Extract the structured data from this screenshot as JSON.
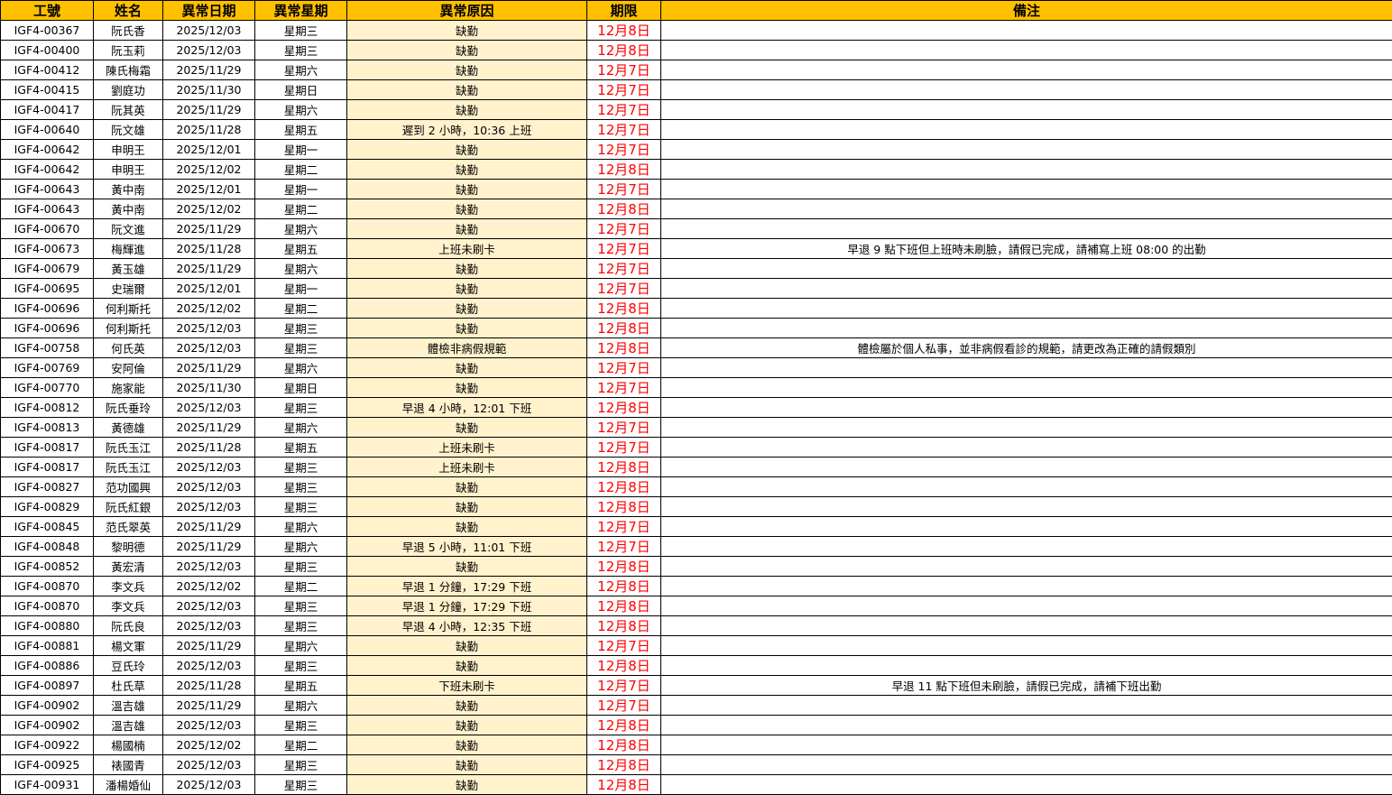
{
  "headers": {
    "id": "工號",
    "name": "姓名",
    "date": "異常日期",
    "weekday": "異常星期",
    "reason": "異常原因",
    "deadline": "期限",
    "note": "備注"
  },
  "colors": {
    "header_background": "#ffc000",
    "reason_background": "#fff2cc",
    "deadline_text": "#ff0000",
    "grid_lines": "#000000"
  },
  "rows": [
    {
      "id": "IGF4-00367",
      "name": "阮氏香",
      "date": "2025/12/03",
      "weekday": "星期三",
      "reason": "缺勤",
      "deadline": "12月8日",
      "note": ""
    },
    {
      "id": "IGF4-00400",
      "name": "阮玉莉",
      "date": "2025/12/03",
      "weekday": "星期三",
      "reason": "缺勤",
      "deadline": "12月8日",
      "note": ""
    },
    {
      "id": "IGF4-00412",
      "name": "陳氏梅霜",
      "date": "2025/11/29",
      "weekday": "星期六",
      "reason": "缺勤",
      "deadline": "12月7日",
      "note": ""
    },
    {
      "id": "IGF4-00415",
      "name": "劉庭功",
      "date": "2025/11/30",
      "weekday": "星期日",
      "reason": "缺勤",
      "deadline": "12月7日",
      "note": ""
    },
    {
      "id": "IGF4-00417",
      "name": "阮其英",
      "date": "2025/11/29",
      "weekday": "星期六",
      "reason": "缺勤",
      "deadline": "12月7日",
      "note": ""
    },
    {
      "id": "IGF4-00640",
      "name": "阮文雄",
      "date": "2025/11/28",
      "weekday": "星期五",
      "reason": "遲到 2 小時，10:36 上班",
      "deadline": "12月7日",
      "note": ""
    },
    {
      "id": "IGF4-00642",
      "name": "申明王",
      "date": "2025/12/01",
      "weekday": "星期一",
      "reason": "缺勤",
      "deadline": "12月7日",
      "note": ""
    },
    {
      "id": "IGF4-00642",
      "name": "申明王",
      "date": "2025/12/02",
      "weekday": "星期二",
      "reason": "缺勤",
      "deadline": "12月8日",
      "note": ""
    },
    {
      "id": "IGF4-00643",
      "name": "黃中南",
      "date": "2025/12/01",
      "weekday": "星期一",
      "reason": "缺勤",
      "deadline": "12月7日",
      "note": ""
    },
    {
      "id": "IGF4-00643",
      "name": "黃中南",
      "date": "2025/12/02",
      "weekday": "星期二",
      "reason": "缺勤",
      "deadline": "12月8日",
      "note": ""
    },
    {
      "id": "IGF4-00670",
      "name": "阮文進",
      "date": "2025/11/29",
      "weekday": "星期六",
      "reason": "缺勤",
      "deadline": "12月7日",
      "note": ""
    },
    {
      "id": "IGF4-00673",
      "name": "梅輝進",
      "date": "2025/11/28",
      "weekday": "星期五",
      "reason": "上班未刷卡",
      "deadline": "12月7日",
      "note": "早退 9 點下班但上班時未刷臉，請假已完成，請補寫上班 08:00 的出勤"
    },
    {
      "id": "IGF4-00679",
      "name": "黃玉雄",
      "date": "2025/11/29",
      "weekday": "星期六",
      "reason": "缺勤",
      "deadline": "12月7日",
      "note": ""
    },
    {
      "id": "IGF4-00695",
      "name": "史瑞爾",
      "date": "2025/12/01",
      "weekday": "星期一",
      "reason": "缺勤",
      "deadline": "12月7日",
      "note": ""
    },
    {
      "id": "IGF4-00696",
      "name": "何利斯托",
      "date": "2025/12/02",
      "weekday": "星期二",
      "reason": "缺勤",
      "deadline": "12月8日",
      "note": ""
    },
    {
      "id": "IGF4-00696",
      "name": "何利斯托",
      "date": "2025/12/03",
      "weekday": "星期三",
      "reason": "缺勤",
      "deadline": "12月8日",
      "note": ""
    },
    {
      "id": "IGF4-00758",
      "name": "何氏英",
      "date": "2025/12/03",
      "weekday": "星期三",
      "reason": "體檢非病假規範",
      "deadline": "12月8日",
      "note": "體檢屬於個人私事，並非病假看診的規範，請更改為正確的請假類別"
    },
    {
      "id": "IGF4-00769",
      "name": "安阿倫",
      "date": "2025/11/29",
      "weekday": "星期六",
      "reason": "缺勤",
      "deadline": "12月7日",
      "note": ""
    },
    {
      "id": "IGF4-00770",
      "name": "施家能",
      "date": "2025/11/30",
      "weekday": "星期日",
      "reason": "缺勤",
      "deadline": "12月7日",
      "note": ""
    },
    {
      "id": "IGF4-00812",
      "name": "阮氏垂玲",
      "date": "2025/12/03",
      "weekday": "星期三",
      "reason": "早退 4 小時，12:01 下班",
      "deadline": "12月8日",
      "note": ""
    },
    {
      "id": "IGF4-00813",
      "name": "黃德雄",
      "date": "2025/11/29",
      "weekday": "星期六",
      "reason": "缺勤",
      "deadline": "12月7日",
      "note": ""
    },
    {
      "id": "IGF4-00817",
      "name": "阮氏玉江",
      "date": "2025/11/28",
      "weekday": "星期五",
      "reason": "上班未刷卡",
      "deadline": "12月7日",
      "note": ""
    },
    {
      "id": "IGF4-00817",
      "name": "阮氏玉江",
      "date": "2025/12/03",
      "weekday": "星期三",
      "reason": "上班未刷卡",
      "deadline": "12月8日",
      "note": ""
    },
    {
      "id": "IGF4-00827",
      "name": "范功國興",
      "date": "2025/12/03",
      "weekday": "星期三",
      "reason": "缺勤",
      "deadline": "12月8日",
      "note": ""
    },
    {
      "id": "IGF4-00829",
      "name": "阮氏紅銀",
      "date": "2025/12/03",
      "weekday": "星期三",
      "reason": "缺勤",
      "deadline": "12月8日",
      "note": ""
    },
    {
      "id": "IGF4-00845",
      "name": "范氏翠英",
      "date": "2025/11/29",
      "weekday": "星期六",
      "reason": "缺勤",
      "deadline": "12月7日",
      "note": ""
    },
    {
      "id": "IGF4-00848",
      "name": "黎明德",
      "date": "2025/11/29",
      "weekday": "星期六",
      "reason": "早退 5 小時，11:01 下班",
      "deadline": "12月7日",
      "note": ""
    },
    {
      "id": "IGF4-00852",
      "name": "黃宏清",
      "date": "2025/12/03",
      "weekday": "星期三",
      "reason": "缺勤",
      "deadline": "12月8日",
      "note": ""
    },
    {
      "id": "IGF4-00870",
      "name": "李文兵",
      "date": "2025/12/02",
      "weekday": "星期二",
      "reason": "早退 1 分鐘，17:29 下班",
      "deadline": "12月8日",
      "note": ""
    },
    {
      "id": "IGF4-00870",
      "name": "李文兵",
      "date": "2025/12/03",
      "weekday": "星期三",
      "reason": "早退 1 分鐘，17:29 下班",
      "deadline": "12月8日",
      "note": ""
    },
    {
      "id": "IGF4-00880",
      "name": "阮氏良",
      "date": "2025/12/03",
      "weekday": "星期三",
      "reason": "早退 4 小時，12:35 下班",
      "deadline": "12月8日",
      "note": ""
    },
    {
      "id": "IGF4-00881",
      "name": "楊文軍",
      "date": "2025/11/29",
      "weekday": "星期六",
      "reason": "缺勤",
      "deadline": "12月7日",
      "note": ""
    },
    {
      "id": "IGF4-00886",
      "name": "豆氏玲",
      "date": "2025/12/03",
      "weekday": "星期三",
      "reason": "缺勤",
      "deadline": "12月8日",
      "note": ""
    },
    {
      "id": "IGF4-00897",
      "name": "杜氏草",
      "date": "2025/11/28",
      "weekday": "星期五",
      "reason": "下班未刷卡",
      "deadline": "12月7日",
      "note": "早退 11 點下班但未刷臉，請假已完成，請補下班出勤"
    },
    {
      "id": "IGF4-00902",
      "name": "溫吉雄",
      "date": "2025/11/29",
      "weekday": "星期六",
      "reason": "缺勤",
      "deadline": "12月7日",
      "note": ""
    },
    {
      "id": "IGF4-00902",
      "name": "溫吉雄",
      "date": "2025/12/03",
      "weekday": "星期三",
      "reason": "缺勤",
      "deadline": "12月8日",
      "note": ""
    },
    {
      "id": "IGF4-00922",
      "name": "楊國楠",
      "date": "2025/12/02",
      "weekday": "星期二",
      "reason": "缺勤",
      "deadline": "12月8日",
      "note": ""
    },
    {
      "id": "IGF4-00925",
      "name": "裱國青",
      "date": "2025/12/03",
      "weekday": "星期三",
      "reason": "缺勤",
      "deadline": "12月8日",
      "note": ""
    },
    {
      "id": "IGF4-00931",
      "name": "潘楊婚仙",
      "date": "2025/12/03",
      "weekday": "星期三",
      "reason": "缺勤",
      "deadline": "12月8日",
      "note": ""
    }
  ]
}
